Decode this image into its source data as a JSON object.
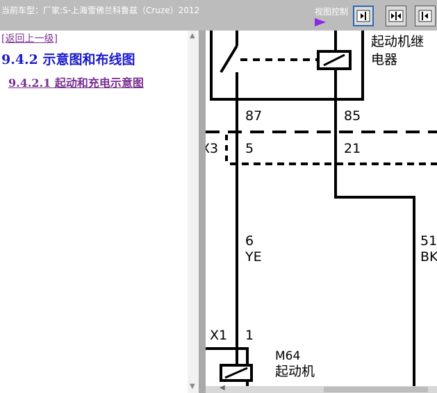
{
  "header": {
    "vehicle_title": "当前车型：厂家:S-上海雪佛兰科鲁兹（Cruze）2012",
    "view_control_label": "视图控制"
  },
  "left_panel": {
    "back_link": "[返回上一级]",
    "section_title": "9.4.2 示意图和布线图",
    "subsection_link": "9.4.2.1 起动和充电示意图"
  },
  "diagram": {
    "relay_label_line1": "起动机继",
    "relay_label_line2": "电器",
    "pin_87": "87",
    "pin_85": "85",
    "connector_partial": "X3",
    "pin_5": "5",
    "pin_21": "21",
    "wire_6_number": "6",
    "wire_6_color": "YE",
    "wire_51_number": "51",
    "wire_51_color": "BK",
    "connector_x1": "X1",
    "pin_1": "1",
    "starter_code": "M64",
    "starter_name": "起动机"
  }
}
